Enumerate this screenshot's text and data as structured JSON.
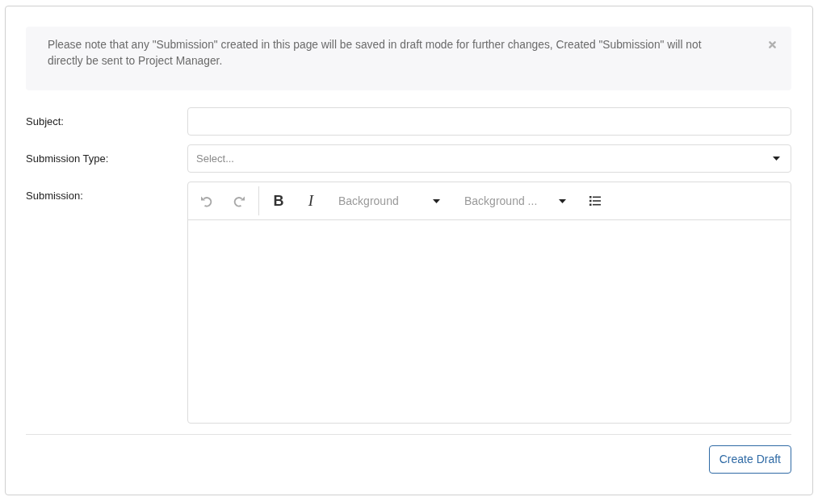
{
  "alert": {
    "text": "Please note that any \"Submission\" created in this page will be saved in draft mode for further changes, Created \"Submission\" will not directly be sent to Project Manager.",
    "dismissible": true
  },
  "form": {
    "fields": [
      {
        "kind": "text",
        "label": "Subject:"
      },
      {
        "kind": "select",
        "label": "Submission Type:",
        "placeholder": "Select..."
      },
      {
        "kind": "editor",
        "label": "Submission:",
        "toolbar": [
          {
            "kind": "undo",
            "disabled": true
          },
          {
            "kind": "redo",
            "disabled": true
          },
          {
            "kind": "separator"
          },
          {
            "kind": "bold",
            "label": "B"
          },
          {
            "kind": "italic",
            "label": "I"
          },
          {
            "kind": "dropdown",
            "placeholder": "Background"
          },
          {
            "kind": "dropdown",
            "placeholder": "Background ..."
          },
          {
            "kind": "bullet_list"
          }
        ]
      }
    ]
  },
  "actions": [
    "Create Draft"
  ]
}
